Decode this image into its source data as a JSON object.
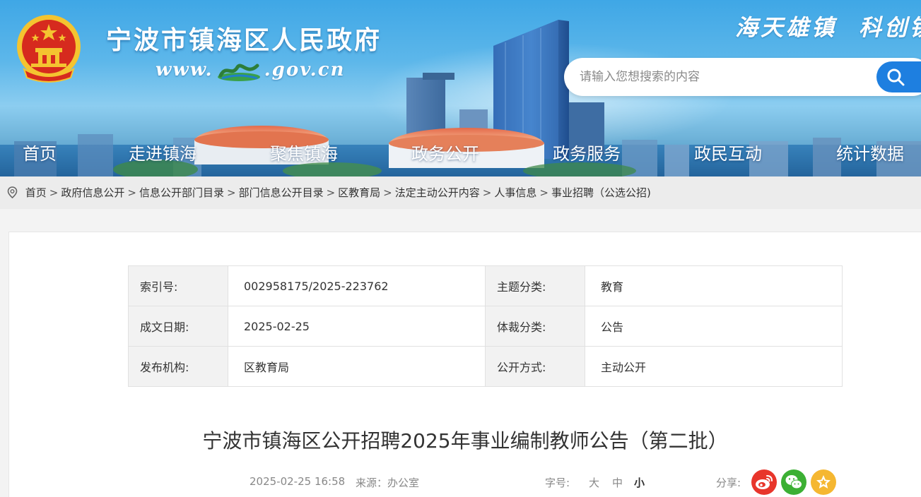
{
  "header": {
    "site_title": "宁波市镇海区人民政府",
    "site_url_prefix": "www.",
    "site_url_suffix": ".gov.cn",
    "slogan_1": "海天雄镇",
    "slogan_2": "科创镇",
    "brand_color": "#1e7fe0"
  },
  "search": {
    "placeholder": "请输入您想搜索的内容",
    "button_icon": "search-icon"
  },
  "nav": {
    "items": [
      "首页",
      "走进镇海",
      "聚焦镇海",
      "政务公开",
      "政务服务",
      "政民互动",
      "统计数据"
    ]
  },
  "breadcrumb": {
    "icon": "location-pin-icon",
    "items": [
      "首页",
      "政府信息公开",
      "信息公开部门目录",
      "部门信息公开目录",
      "区教育局",
      "法定主动公开内容",
      "人事信息",
      "事业招聘（公选公招)"
    ],
    "separator": ">"
  },
  "meta": {
    "index_label": "索引号:",
    "index_value": "002958175/2025-223762",
    "topic_label": "主题分类:",
    "topic_value": "教育",
    "date_label": "成文日期:",
    "date_value": "2025-02-25",
    "genre_label": "体裁分类:",
    "genre_value": "公告",
    "publisher_label": "发布机构:",
    "publisher_value": "区教育局",
    "disclosure_label": "公开方式:",
    "disclosure_value": "主动公开"
  },
  "article": {
    "title": "宁波市镇海区公开招聘2025年事业编制教师公告（第二批）",
    "datetime": "2025-02-25 16:58",
    "source": "来源：办公室",
    "font_size_label": "字号:",
    "font_sizes": [
      "大",
      "中",
      "小"
    ],
    "active_font_size": "小",
    "share_label": "分享:",
    "share_icons": [
      "weibo-icon",
      "wechat-icon",
      "favorite-star-icon"
    ],
    "share_colors": [
      "#e8352b",
      "#3cb034",
      "#f5b731"
    ]
  }
}
